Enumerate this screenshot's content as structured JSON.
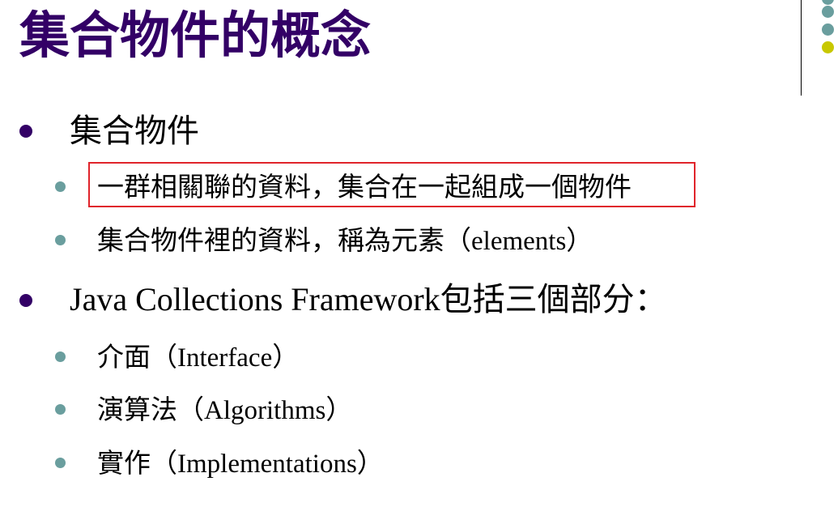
{
  "slide": {
    "title": "集合物件的概念"
  },
  "bullets": [
    {
      "level": 1,
      "text": "集合物件"
    },
    {
      "level": 2,
      "text": "一群相關聯的資料，集合在一起組成一個物件",
      "highlighted": true
    },
    {
      "level": 2,
      "text": "集合物件裡的資料，稱為元素（elements）"
    },
    {
      "level": 1,
      "text": "Java Collections Framework包括三個部分："
    },
    {
      "level": 2,
      "text": "介面（Interface）"
    },
    {
      "level": 2,
      "text": "演算法（Algorithms）"
    },
    {
      "level": 2,
      "text": "實作（Implementations）"
    }
  ],
  "colors": {
    "title": "#330066",
    "level1_bullet": "#330066",
    "level2_bullet": "#6a9e9e",
    "highlight_border": "#e0242b",
    "accent_dot": "#c8c800"
  }
}
